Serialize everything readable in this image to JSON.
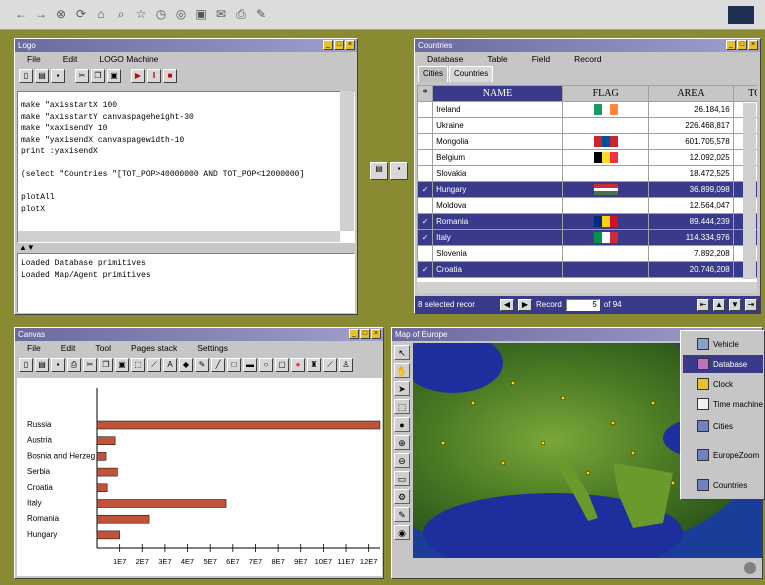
{
  "top_toolbar": {
    "icons": [
      "back-icon",
      "forward-icon",
      "stop-icon",
      "refresh-icon",
      "home-icon",
      "search-icon",
      "favorites-icon",
      "history-icon",
      "channels-icon",
      "fullscreen-icon",
      "mail-icon",
      "print-icon",
      "edit-icon"
    ]
  },
  "logo_window": {
    "title": "Logo",
    "menu": [
      "File",
      "Edit",
      "LOGO Machine"
    ],
    "code_lines": [
      "make \"axisstartX 100",
      "make \"axisstartY canvaspageheight-30",
      "make \"xaxisendY 10",
      "make \"yaxisendX canvaspagewidth-10",
      "print :yaxisendX",
      "",
      "(select \"Countries \"[TOT_POP>40000000 AND TOT_POP<12000000]",
      "",
      "plotAll",
      "plotX"
    ],
    "output_lines": [
      "Loaded Database primitives",
      "Loaded Map/Agent primitives"
    ]
  },
  "countries_window": {
    "title": "Countries",
    "menu": [
      "Database",
      "Table",
      "Field",
      "Record"
    ],
    "tabs": [
      "Cities",
      "Countries"
    ],
    "columns": [
      "*",
      "NAME",
      "FLAG",
      "AREA",
      "TO"
    ],
    "rows": [
      {
        "name": "Ireland",
        "area": "26.184,16",
        "selected": false,
        "flag": [
          "#169b62",
          "#fff",
          "#ff883e"
        ]
      },
      {
        "name": "Ukraine",
        "area": "226.468,817",
        "selected": false,
        "flag": []
      },
      {
        "name": "Mongolia",
        "area": "601.705,578",
        "selected": false,
        "flag": [
          "#c4272f",
          "#015197",
          "#c4272f"
        ]
      },
      {
        "name": "Belgium",
        "area": "12.092,025",
        "selected": false,
        "flag": [
          "#000",
          "#fdda24",
          "#ef3340"
        ]
      },
      {
        "name": "Slovakia",
        "area": "18.472,525",
        "selected": false,
        "flag": []
      },
      {
        "name": "Hungary",
        "area": "36.899,098",
        "selected": true,
        "flag": [
          "#ce2939",
          "#fff",
          "#477050"
        ],
        "h": true
      },
      {
        "name": "Moldova",
        "area": "12.564,047",
        "selected": false,
        "flag": []
      },
      {
        "name": "Romania",
        "area": "89.444,239",
        "selected": true,
        "flag": [
          "#002b7f",
          "#fcd116",
          "#ce1126"
        ]
      },
      {
        "name": "Italy",
        "area": "114.334,976",
        "selected": true,
        "flag": [
          "#009246",
          "#fff",
          "#ce2b37"
        ]
      },
      {
        "name": "Slovenia",
        "area": "7.892,208",
        "selected": false,
        "flag": []
      },
      {
        "name": "Croatia",
        "area": "20.746,208",
        "selected": true,
        "flag": []
      }
    ],
    "status": "8 selected recor",
    "record_label": "Record",
    "record_num": "5",
    "record_total": "of 94"
  },
  "canvas_window": {
    "title": "Canvas",
    "menu": [
      "File",
      "Edit",
      "Tool",
      "Pages stack",
      "Settings"
    ]
  },
  "map_window": {
    "title": "Map of Europe"
  },
  "popup_menu": {
    "items": [
      "Vehicle",
      "Database",
      "Clock",
      "Time machine",
      "Cities",
      "EuropeZoom",
      "Countries"
    ],
    "selected": "Database"
  },
  "chart_data": {
    "type": "bar",
    "categories": [
      "Russia",
      "Austria",
      "Bosnia and Herzeg",
      "Serbia",
      "Croatia",
      "Italy",
      "Romania",
      "Hungary"
    ],
    "values": [
      150000000,
      8000000,
      4000000,
      9000000,
      4500000,
      57000000,
      23000000,
      10000000
    ],
    "xticks": [
      "1E7",
      "2E7",
      "3E7",
      "4E7",
      "5E7",
      "6E7",
      "7E7",
      "8E7",
      "9E7",
      "10E7",
      "11E7",
      "12E7"
    ],
    "xlim": [
      0,
      125000000
    ],
    "title": "",
    "xlabel": "",
    "ylabel": "",
    "bar_color": "#c0543a"
  }
}
